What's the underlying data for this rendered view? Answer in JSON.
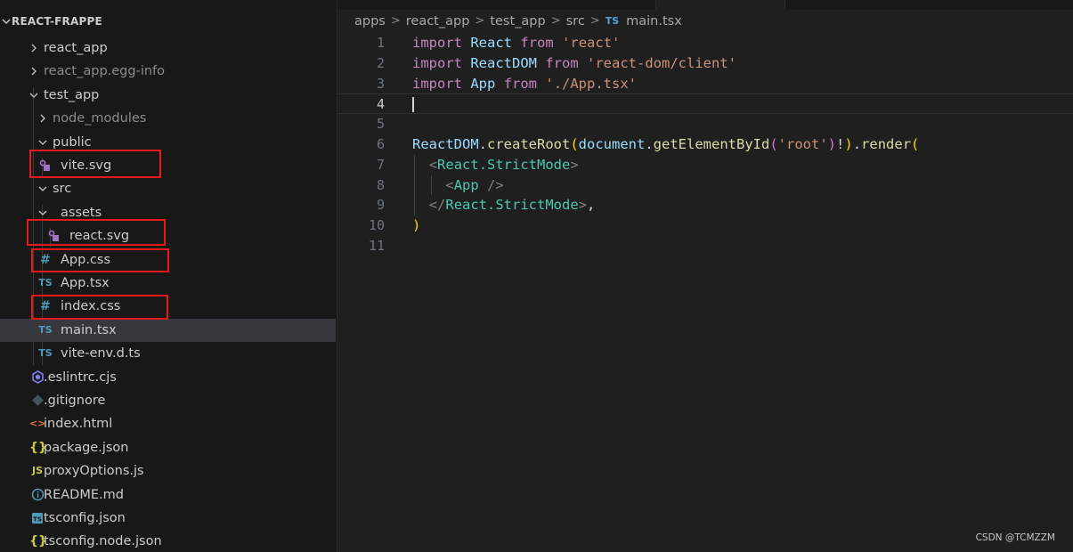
{
  "explorer": {
    "root_label": "REACT-FRAPPE",
    "items": [
      {
        "label": "react_app",
        "kind": "folder",
        "state": "collapsed",
        "dim": false
      },
      {
        "label": "react_app.egg-info",
        "kind": "folder",
        "state": "collapsed",
        "dim": true
      },
      {
        "label": "test_app",
        "kind": "folder",
        "state": "expanded",
        "dim": false
      },
      {
        "label": "node_modules",
        "kind": "folder",
        "state": "collapsed",
        "dim": true
      },
      {
        "label": "public",
        "kind": "folder",
        "state": "expanded",
        "dim": false
      },
      {
        "label": "vite.svg",
        "kind": "file",
        "icon": "svg-file-icon",
        "icon_text": "",
        "dim": false
      },
      {
        "label": "src",
        "kind": "folder",
        "state": "expanded",
        "dim": false
      },
      {
        "label": "assets",
        "kind": "folder",
        "state": "expanded",
        "dim": false
      },
      {
        "label": "react.svg",
        "kind": "file",
        "icon": "svg-file-icon",
        "icon_text": "",
        "dim": false
      },
      {
        "label": "App.css",
        "kind": "file",
        "icon": "css-file-icon",
        "icon_text": "#",
        "dim": false
      },
      {
        "label": "App.tsx",
        "kind": "file",
        "icon": "typescript-file-icon",
        "icon_text": "TS",
        "dim": false
      },
      {
        "label": "index.css",
        "kind": "file",
        "icon": "css-file-icon",
        "icon_text": "#",
        "dim": false
      },
      {
        "label": "main.tsx",
        "kind": "file",
        "icon": "typescript-file-icon",
        "icon_text": "TS",
        "dim": false,
        "selected": true
      },
      {
        "label": "vite-env.d.ts",
        "kind": "file",
        "icon": "typescript-file-icon",
        "icon_text": "TS",
        "dim": false
      },
      {
        "label": ".eslintrc.cjs",
        "kind": "file",
        "icon": "eslint-file-icon",
        "icon_text": "",
        "dim": false
      },
      {
        "label": ".gitignore",
        "kind": "file",
        "icon": "git-file-icon",
        "icon_text": "",
        "dim": false
      },
      {
        "label": "index.html",
        "kind": "file",
        "icon": "html-file-icon",
        "icon_text": "<>",
        "dim": false
      },
      {
        "label": "package.json",
        "kind": "file",
        "icon": "json-file-icon",
        "icon_text": "{}",
        "dim": false
      },
      {
        "label": "proxyOptions.js",
        "kind": "file",
        "icon": "javascript-file-icon",
        "icon_text": "JS",
        "dim": false
      },
      {
        "label": "README.md",
        "kind": "file",
        "icon": "info-file-icon",
        "icon_text": "i",
        "dim": false
      },
      {
        "label": "tsconfig.json",
        "kind": "file",
        "icon": "tsconfig-file-icon",
        "icon_text": "TS",
        "dim": false
      },
      {
        "label": "tsconfig.node.json",
        "kind": "file",
        "icon": "json-file-icon",
        "icon_text": "{}",
        "dim": false
      }
    ]
  },
  "breadcrumb": {
    "segments": [
      "apps",
      "react_app",
      "test_app",
      "src"
    ],
    "file_icon": "TS",
    "file": "main.tsx"
  },
  "editor": {
    "active_line": 4,
    "lines": [
      {
        "num": "1",
        "text": "import React from 'react'"
      },
      {
        "num": "2",
        "text": "import ReactDOM from 'react-dom/client'"
      },
      {
        "num": "3",
        "text": "import App from './App.tsx'"
      },
      {
        "num": "4",
        "text": ""
      },
      {
        "num": "5",
        "text": ""
      },
      {
        "num": "6",
        "text": "ReactDOM.createRoot(document.getElementById('root')!).render("
      },
      {
        "num": "7",
        "text": "  <React.StrictMode>"
      },
      {
        "num": "8",
        "text": "    <App />"
      },
      {
        "num": "9",
        "text": "  </React.StrictMode>,"
      },
      {
        "num": "10",
        "text": ")"
      },
      {
        "num": "11",
        "text": ""
      }
    ]
  },
  "highlighted_items": [
    "vite.svg",
    "react.svg",
    "App.css",
    "index.css"
  ],
  "watermark": "CSDN @TCMZZM"
}
